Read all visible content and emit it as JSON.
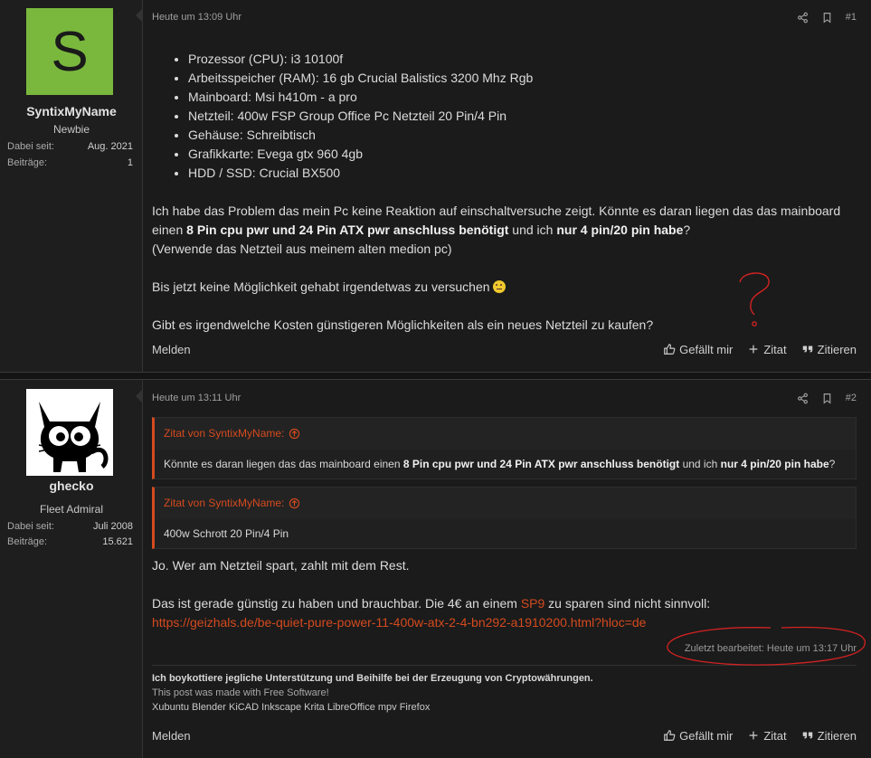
{
  "posts": [
    {
      "user": {
        "avatar_letter": "S",
        "avatar_color": "#7ab83d",
        "name": "SyntixMyName",
        "title": "Newbie",
        "stats": [
          {
            "label": "Dabei seit:",
            "value": "Aug. 2021"
          },
          {
            "label": "Beiträge:",
            "value": "1"
          }
        ]
      },
      "time": "Heute um 13:09 Uhr",
      "number": "#1",
      "specs": [
        "Prozessor (CPU): i3 10100f",
        "Arbeitsspeicher (RAM): 16 gb Crucial Balistics 3200 Mhz Rgb",
        "Mainboard: Msi h410m - a pro",
        "Netzteil: 400w FSP Group Office Pc Netzteil 20 Pin/4 Pin",
        "Gehäuse: Schreibtisch",
        "Grafikkarte: Evega gtx 960 4gb",
        "HDD / SSD: Crucial BX500"
      ],
      "p1a": "Ich habe das Problem das mein Pc keine Reaktion auf einschaltversuche zeigt. Könnte es daran liegen das das mainboard einen ",
      "p1b": "8 Pin cpu pwr und 24 Pin ATX pwr anschluss benötigt",
      "p1c": " und ich ",
      "p1d": "nur 4 pin/20 pin habe",
      "p1e": "?",
      "p1f": "(Verwende das Netzteil aus meinem alten medion pc)",
      "p2": "Bis jetzt keine Möglichkeit gehabt irgendetwas zu versuchen ",
      "p3": "Gibt es irgendwelche Kosten günstigeren Möglichkeiten als ein neues Netzteil zu kaufen?"
    },
    {
      "user": {
        "name": "ghecko",
        "title": "Fleet Admiral",
        "stats": [
          {
            "label": "Dabei seit:",
            "value": "Juli 2008"
          },
          {
            "label": "Beiträge:",
            "value": "15.621"
          }
        ]
      },
      "time": "Heute um 13:11 Uhr",
      "number": "#2",
      "quote1": {
        "header": "Zitat von SyntixMyName:",
        "a": "Könnte es daran liegen das das mainboard einen ",
        "b": "8 Pin cpu pwr und 24 Pin ATX pwr anschluss benötigt",
        "c": " und ich ",
        "d": "nur 4 pin/20 pin habe",
        "e": "?"
      },
      "quote2": {
        "header": "Zitat von SyntixMyName:",
        "text": "400w Schrott 20 Pin/4 Pin"
      },
      "p1": "Jo. Wer am Netzteil spart, zahlt mit dem Rest.",
      "p2a": "Das ist gerade günstig zu haben und brauchbar. Die 4€ an einem ",
      "p2link": "SP9",
      "p2b": " zu sparen sind nicht sinnvoll:",
      "url": "https://geizhals.de/be-quiet-pure-power-11-400w-atx-2-4-bn292-a1910200.html?hloc=de",
      "edited": "Zuletzt bearbeitet: Heute um 13:17 Uhr",
      "sig1": "Ich boykottiere jegliche Unterstützung und Beihilfe bei der Erzeugung von Cryptowährungen.",
      "sig2": "This post was made with Free Software!",
      "sig3": "Xubuntu Blender KiCAD Inkscape Krita LibreOffice mpv Firefox"
    }
  ],
  "actions": {
    "report": "Melden",
    "like": "Gefällt mir",
    "quote_add": "Zitat",
    "reply": "Zitieren"
  },
  "colors": {
    "accent": "#d44a1e",
    "background": "#1b1b1b"
  }
}
